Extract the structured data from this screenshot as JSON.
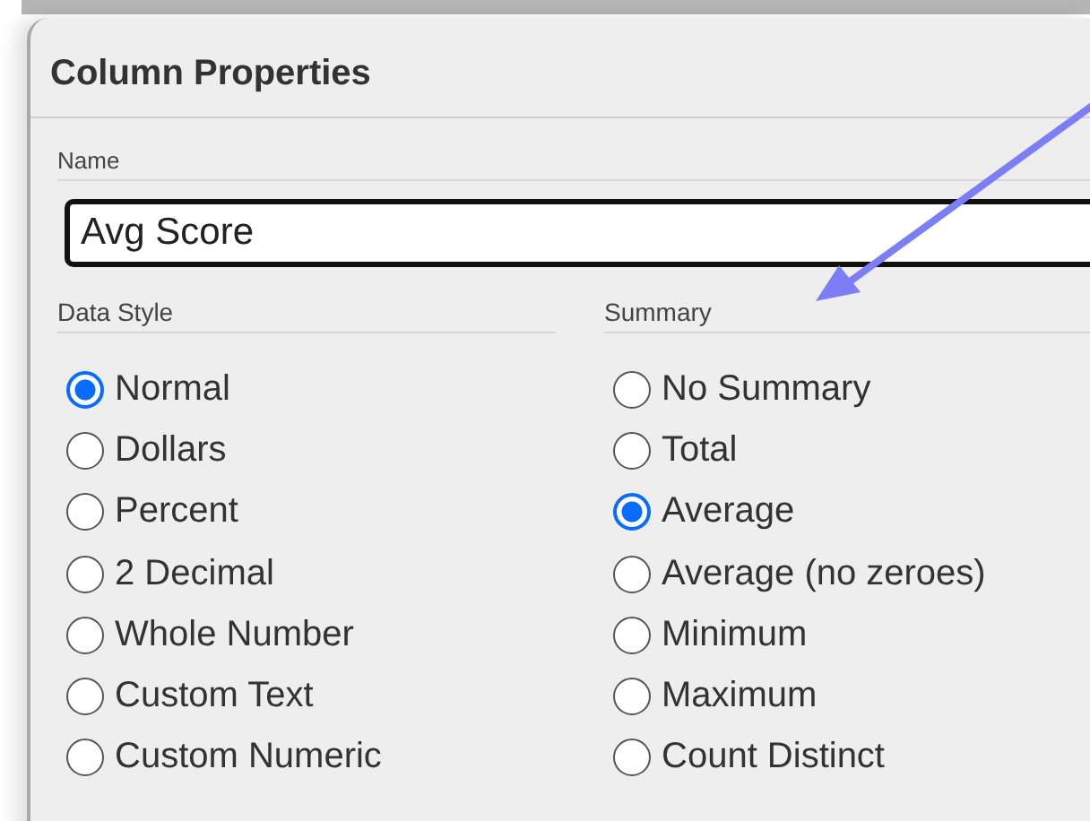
{
  "dialog": {
    "title": "Column Properties"
  },
  "name_field": {
    "label": "Name",
    "value": "Avg Score"
  },
  "data_style": {
    "label": "Data Style",
    "options": [
      {
        "label": "Normal",
        "selected": true
      },
      {
        "label": "Dollars",
        "selected": false
      },
      {
        "label": "Percent",
        "selected": false
      },
      {
        "label": "2 Decimal",
        "selected": false
      },
      {
        "label": "Whole Number",
        "selected": false
      },
      {
        "label": "Custom Text",
        "selected": false
      },
      {
        "label": "Custom Numeric",
        "selected": false
      }
    ]
  },
  "summary": {
    "label": "Summary",
    "options": [
      {
        "label": "No Summary",
        "selected": false
      },
      {
        "label": "Total",
        "selected": false
      },
      {
        "label": "Average",
        "selected": true
      },
      {
        "label": "Average (no zeroes)",
        "selected": false
      },
      {
        "label": "Minimum",
        "selected": false
      },
      {
        "label": "Maximum",
        "selected": false
      },
      {
        "label": "Count Distinct",
        "selected": false
      }
    ]
  }
}
